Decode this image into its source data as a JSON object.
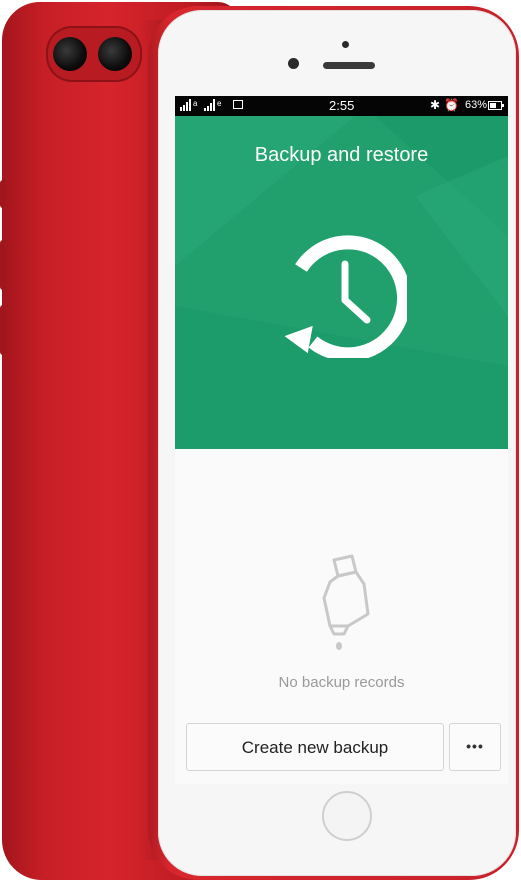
{
  "status_bar": {
    "carrier_letters": [
      "a",
      "e"
    ],
    "time": "2:55",
    "bluetooth_icon": "bluetooth-icon",
    "alarm_icon": "alarm-icon",
    "battery_percent": "63%",
    "battery_level": 0.63
  },
  "header": {
    "title": "Backup and restore",
    "icon": "backup-clock-icon",
    "background_color": "#21a06e"
  },
  "empty_state": {
    "icon": "empty-bottle-icon",
    "message": "No backup records"
  },
  "footer": {
    "create_button_label": "Create new backup",
    "more_button_label": "•••"
  },
  "device": {
    "color": "#d6242b"
  }
}
